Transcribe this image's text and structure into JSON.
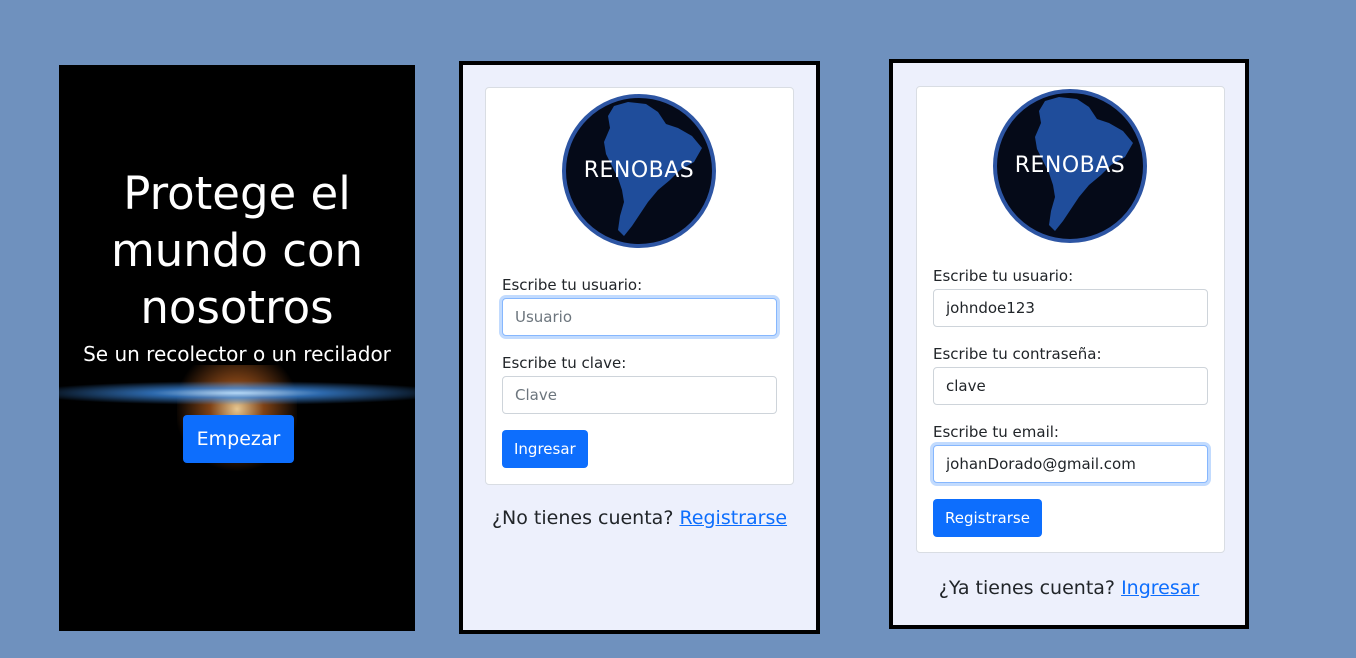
{
  "splash": {
    "title_line1": "Protege el",
    "title_line2": "mundo con",
    "title_line3": "nosotros",
    "subtitle": "Se un recolector o un recilador",
    "start_button": "Empezar"
  },
  "login": {
    "logo_text": "RENOBAS",
    "user_label": "Escribe tu usuario:",
    "user_placeholder": "Usuario",
    "password_label": "Escribe tu clave:",
    "password_placeholder": "Clave",
    "submit_button": "Ingresar",
    "footer_text": "¿No tienes cuenta?",
    "footer_link": "Registrarse"
  },
  "signup": {
    "logo_text": "RENOBAS",
    "user_label": "Escribe tu usuario:",
    "user_value": "johndoe123",
    "password_label": "Escribe tu contraseña:",
    "password_value": "clave",
    "email_label": "Escribe tu email:",
    "email_value": "johanDorado@gmail.com",
    "submit_button": "Registrarse",
    "footer_text": "¿Ya tienes cuenta?",
    "footer_link": "Ingresar"
  },
  "colors": {
    "background": "#6f91be",
    "primary": "#0d6efd",
    "frame_bg": "#edf0fc",
    "logo_ring": "#2d55a3"
  }
}
